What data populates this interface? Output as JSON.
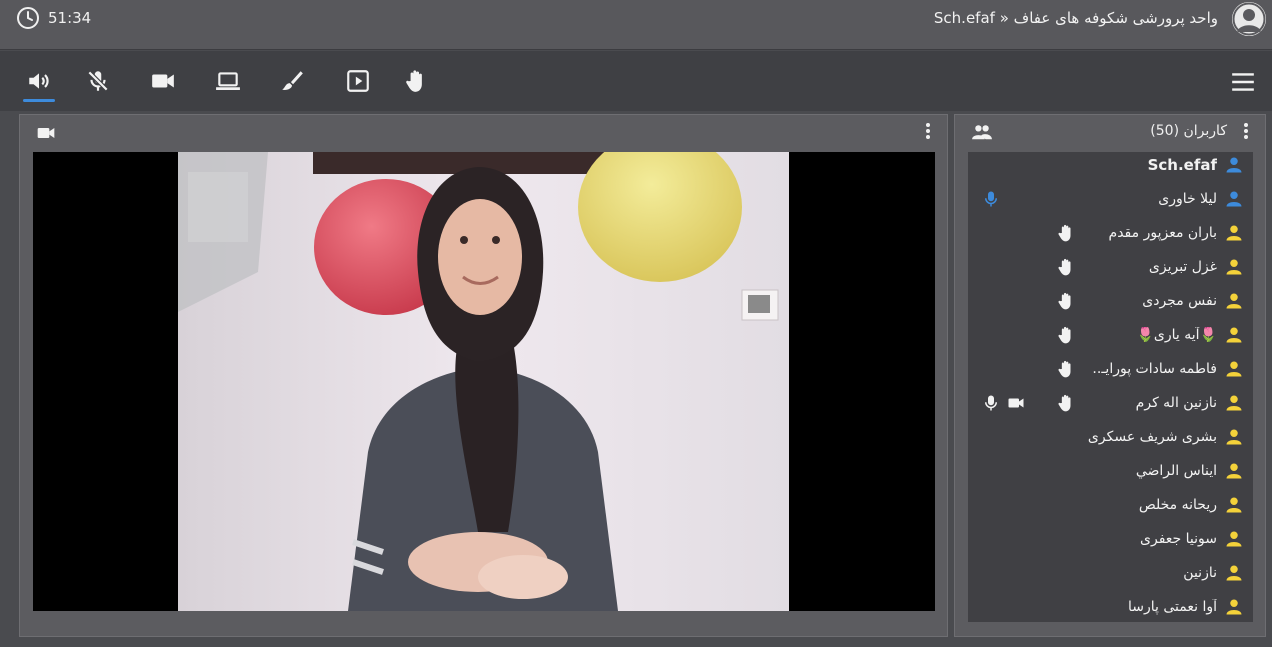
{
  "header": {
    "timer": "51:34",
    "title": "Sch.efaf » واحد پرورشی شکوفه های عفاف"
  },
  "toolbar": {
    "tools": [
      "speaker-icon",
      "mic-muted-icon",
      "camera-icon",
      "screen-share-icon",
      "brush-icon",
      "play-icon",
      "raise-hand-icon"
    ],
    "active": "speaker-icon"
  },
  "users_panel": {
    "title": "کاربران (50)",
    "users": [
      {
        "name": "Sch.efaf",
        "role": "moderator",
        "hand": false,
        "mic": false,
        "cam": false
      },
      {
        "name": "لیلا خاوری",
        "role": "moderator",
        "hand": false,
        "mic": true,
        "cam": false
      },
      {
        "name": "باران معزپور مقدم",
        "role": "viewer",
        "hand": true,
        "mic": false,
        "cam": false
      },
      {
        "name": "غزل تبریزی",
        "role": "viewer",
        "hand": true,
        "mic": false,
        "cam": false
      },
      {
        "name": "نفس مجردی",
        "role": "viewer",
        "hand": true,
        "mic": false,
        "cam": false
      },
      {
        "name": "🌷آیه یاری🌷",
        "role": "viewer",
        "hand": true,
        "mic": false,
        "cam": false
      },
      {
        "name": "فاطمه سادات پورایـ..",
        "role": "viewer",
        "hand": true,
        "mic": false,
        "cam": false
      },
      {
        "name": "نازنین اله کرم",
        "role": "viewer",
        "hand": true,
        "mic": true,
        "cam": true
      },
      {
        "name": "بشری شریف عسکری",
        "role": "viewer",
        "hand": false,
        "mic": false,
        "cam": false
      },
      {
        "name": "ایناس الراضي",
        "role": "viewer",
        "hand": false,
        "mic": false,
        "cam": false
      },
      {
        "name": "ریحانه مخلص",
        "role": "viewer",
        "hand": false,
        "mic": false,
        "cam": false
      },
      {
        "name": "سونیا جعفری",
        "role": "viewer",
        "hand": false,
        "mic": false,
        "cam": false
      },
      {
        "name": "نازنین",
        "role": "viewer",
        "hand": false,
        "mic": false,
        "cam": false
      },
      {
        "name": "آوا نعمتی پارسا",
        "role": "viewer",
        "hand": false,
        "mic": false,
        "cam": false
      }
    ]
  },
  "colors": {
    "moderator_icon": "#3d8bdc",
    "viewer_icon": "#f4d23a",
    "accent": "#3d8bdc"
  }
}
